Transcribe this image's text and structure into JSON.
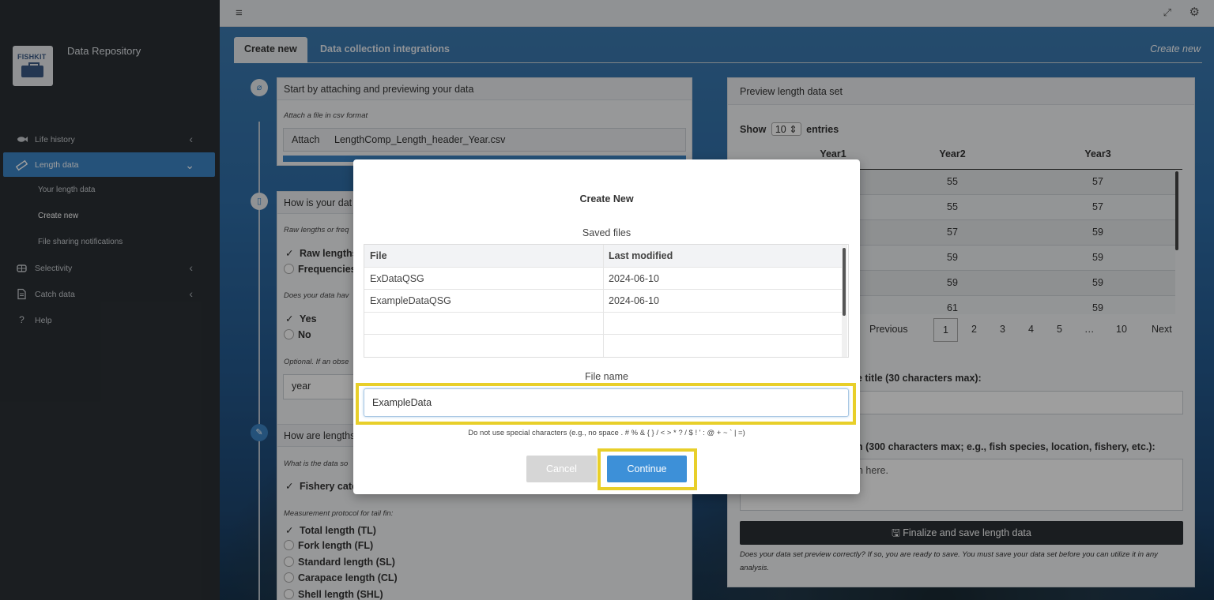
{
  "app": {
    "logo_text": "FISHKIT",
    "title": "Data Repository"
  },
  "sidebar": {
    "items": [
      {
        "label": "Life history",
        "icon": "fish-icon"
      },
      {
        "label": "Length data",
        "icon": "ruler-icon"
      },
      {
        "label": "Selectivity",
        "icon": "net-icon"
      },
      {
        "label": "Catch data",
        "icon": "document-icon"
      },
      {
        "label": "Help",
        "icon": "question-icon"
      }
    ],
    "sub_items": [
      {
        "label": "Your length data"
      },
      {
        "label": "Create new"
      },
      {
        "label": "File sharing notifications"
      }
    ]
  },
  "tabs": {
    "create_new": "Create new",
    "integrations": "Data collection integrations",
    "right_label": "Create new"
  },
  "attach_panel": {
    "title": "Start by attaching and previewing your data",
    "hint": "Attach a file in csv format",
    "button": "Attach",
    "file_name": "LengthComp_Length_header_Year.csv"
  },
  "format_panel": {
    "title": "How is your dat",
    "hint1": "Raw lengths or freq",
    "opt_raw": "Raw lengths",
    "opt_freq": "Frequencies",
    "hint2": "Does your data hav",
    "opt_yes": "Yes",
    "opt_no": "No",
    "hint3": "Optional. If an obse",
    "field_value": "year"
  },
  "measure_panel": {
    "title": "How are lengths",
    "hint1": "What is the data so",
    "opt_fishery": "Fishery catc",
    "hint2": "Measurement protocol for tail fin:",
    "protocols": [
      "Total length (TL)",
      "Fork length (FL)",
      "Standard length (SL)",
      "Carapace length (CL)",
      "Shell length (SHL)"
    ]
  },
  "preview_panel": {
    "title": "Preview length data set",
    "show_label": "Show",
    "show_value": "10",
    "entries_label": "entries",
    "columns": [
      "Year1",
      "Year2",
      "Year3"
    ],
    "rows": [
      [
        "",
        "55",
        "57"
      ],
      [
        "",
        "55",
        "57"
      ],
      [
        "",
        "57",
        "59"
      ],
      [
        "",
        "59",
        "59"
      ],
      [
        "",
        "59",
        "59"
      ],
      [
        "",
        "61",
        "59"
      ]
    ],
    "pager": {
      "previous": "Previous",
      "pages": [
        "1",
        "2",
        "3",
        "4",
        "5",
        "…",
        "10"
      ],
      "next": "Next"
    },
    "title_label": "e title (30 characters max):",
    "desc_label": "n (300 characters max; e.g., fish species, location, fishery, etc.):",
    "desc_placeholder": "n here.",
    "save_button": "Finalize and save length data",
    "save_note": "Does your data set preview correctly? If so, you are ready to save. You must save your data set before you can utilize it in any analysis."
  },
  "modal": {
    "title": "Create New",
    "saved_label": "Saved files",
    "columns": [
      "File",
      "Last modified"
    ],
    "files": [
      {
        "name": "ExDataQSG",
        "modified": "2024-06-10"
      },
      {
        "name": "ExampleDataQSG",
        "modified": "2024-06-10"
      }
    ],
    "file_name_label": "File name",
    "file_name_value": "ExampleData",
    "note": "Do not use special characters (e.g., no space . # % & { } / < > * ? / $ ! ' : @ + ~ ` | =)",
    "cancel": "Cancel",
    "continue": "Continue"
  },
  "colors": {
    "accent": "#3d85c6",
    "highlight": "#e8cf2a",
    "sidebar_bg": "#2b3035"
  }
}
